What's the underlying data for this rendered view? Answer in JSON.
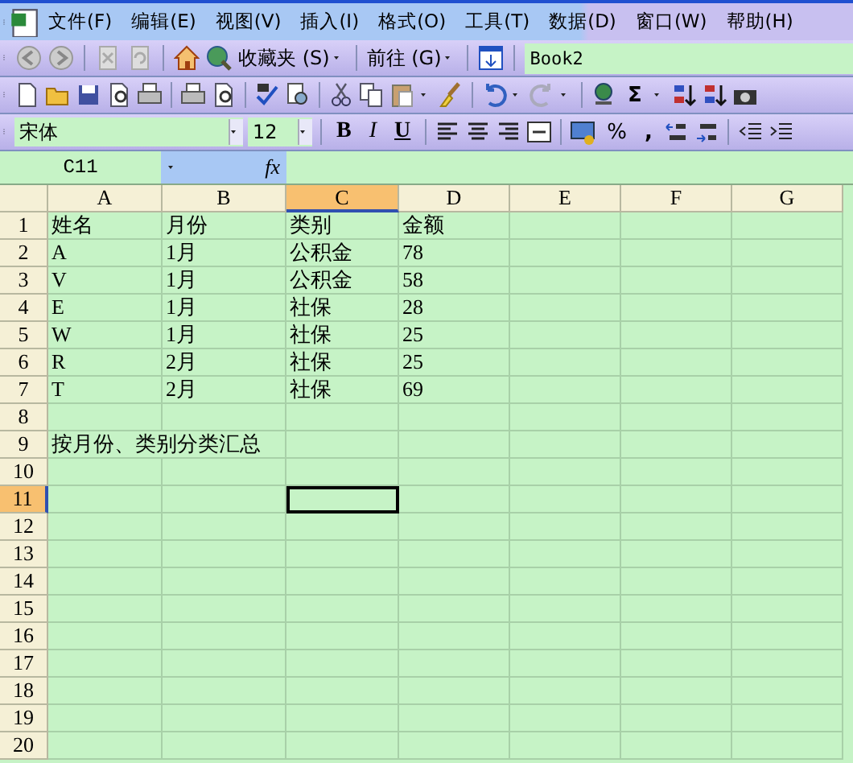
{
  "menu_bar": {
    "items": [
      {
        "label": "文件(F)"
      },
      {
        "label": "编辑(E)"
      },
      {
        "label": "视图(V)"
      },
      {
        "label": "插入(I)"
      },
      {
        "label": "格式(O)"
      },
      {
        "label": "工具(T)"
      },
      {
        "label": "数据(D)"
      },
      {
        "label": "窗口(W)"
      },
      {
        "label": "帮助(H)"
      }
    ]
  },
  "web_toolbar": {
    "favorites": "收藏夹 (S)",
    "go": "前往 (G)",
    "address": "Book2"
  },
  "standard_toolbar": {
    "sum": "Σ"
  },
  "format_toolbar": {
    "font": "宋体",
    "size": "12",
    "bold": "B",
    "italic": "I",
    "underline": "U",
    "percent": "%",
    "comma": ","
  },
  "formula_bar": {
    "name_box": "C11",
    "fx": "fx"
  },
  "sheet": {
    "columns": [
      {
        "label": "A",
        "selected": false
      },
      {
        "label": "B",
        "selected": false
      },
      {
        "label": "C",
        "selected": true
      },
      {
        "label": "D",
        "selected": false
      },
      {
        "label": "E",
        "selected": false
      },
      {
        "label": "F",
        "selected": false
      },
      {
        "label": "G",
        "selected": false
      }
    ],
    "rows": [
      {
        "label": "1",
        "selected": false,
        "cells": [
          "姓名",
          "月份",
          "类别",
          "金额"
        ]
      },
      {
        "label": "2",
        "selected": false,
        "cells": [
          "A",
          "1月",
          "公积金",
          "78"
        ]
      },
      {
        "label": "3",
        "selected": false,
        "cells": [
          "V",
          "1月",
          "公积金",
          "58"
        ]
      },
      {
        "label": "4",
        "selected": false,
        "cells": [
          "E",
          "1月",
          "社保",
          "28"
        ]
      },
      {
        "label": "5",
        "selected": false,
        "cells": [
          "W",
          "1月",
          "社保",
          "25"
        ]
      },
      {
        "label": "6",
        "selected": false,
        "cells": [
          "R",
          "2月",
          "社保",
          "25"
        ]
      },
      {
        "label": "7",
        "selected": false,
        "cells": [
          "T",
          "2月",
          "社保",
          "69"
        ]
      },
      {
        "label": "8",
        "selected": false,
        "cells": []
      },
      {
        "label": "9",
        "selected": false,
        "cells": [
          "按月份、类别分类汇总"
        ]
      },
      {
        "label": "10",
        "selected": false,
        "cells": []
      },
      {
        "label": "11",
        "selected": true,
        "cells": []
      },
      {
        "label": "12",
        "selected": false,
        "cells": []
      },
      {
        "label": "13",
        "selected": false,
        "cells": []
      },
      {
        "label": "14",
        "selected": false,
        "cells": []
      },
      {
        "label": "15",
        "selected": false,
        "cells": []
      },
      {
        "label": "16",
        "selected": false,
        "cells": []
      },
      {
        "label": "17",
        "selected": false,
        "cells": []
      },
      {
        "label": "18",
        "selected": false,
        "cells": []
      },
      {
        "label": "19",
        "selected": false,
        "cells": []
      },
      {
        "label": "20",
        "selected": false,
        "cells": []
      }
    ]
  }
}
